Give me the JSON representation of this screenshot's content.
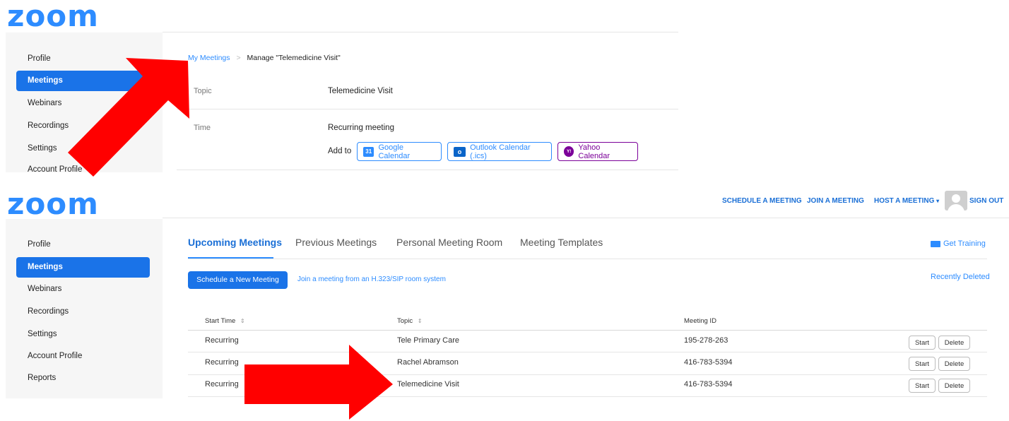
{
  "top_panel": {
    "logo": "zoom",
    "sidebar": [
      {
        "label": "Profile"
      },
      {
        "label": "Meetings"
      },
      {
        "label": "Webinars"
      },
      {
        "label": "Recordings"
      },
      {
        "label": "Settings"
      },
      {
        "label": "Account Profile"
      }
    ],
    "breadcrumb": {
      "root": "My Meetings",
      "separator": ">",
      "current": "Manage \"Telemedicine Visit\""
    },
    "topic_label": "Topic",
    "topic_value": "Telemedicine Visit",
    "time_label": "Time",
    "time_value": "Recurring meeting",
    "add_to_label": "Add to",
    "calendars": {
      "google": {
        "label": "Google Calendar",
        "icon_text": "31"
      },
      "outlook": {
        "label": "Outlook Calendar (.ics)",
        "icon_text": "o"
      },
      "yahoo": {
        "label": "Yahoo Calendar",
        "icon_text": "Y!"
      }
    }
  },
  "bottom_panel": {
    "logo": "zoom",
    "nav": {
      "schedule": "SCHEDULE A MEETING",
      "join": "JOIN A MEETING",
      "host": "HOST A MEETING",
      "sign_out": "SIGN OUT"
    },
    "sidebar": [
      {
        "label": "Profile"
      },
      {
        "label": "Meetings"
      },
      {
        "label": "Webinars"
      },
      {
        "label": "Recordings"
      },
      {
        "label": "Settings"
      },
      {
        "label": "Account Profile"
      },
      {
        "label": "Reports"
      }
    ],
    "tabs": [
      {
        "label": "Upcoming Meetings"
      },
      {
        "label": "Previous Meetings"
      },
      {
        "label": "Personal Meeting Room"
      },
      {
        "label": "Meeting Templates"
      }
    ],
    "get_training": "Get Training",
    "schedule_button": "Schedule a New Meeting",
    "join_room_link": "Join a meeting from an H.323/SIP room system",
    "recently_deleted": "Recently Deleted",
    "table": {
      "headers": {
        "start_time": "Start Time",
        "topic": "Topic",
        "meeting_id": "Meeting ID"
      },
      "sort_glyph": "⇕",
      "rows": [
        {
          "start": "Recurring",
          "topic": "Tele Primary Care",
          "id": "195-278-263",
          "start_btn": "Start",
          "delete_btn": "Delete"
        },
        {
          "start": "Recurring",
          "topic": "Rachel Abramson",
          "id": "416-783-5394",
          "start_btn": "Start",
          "delete_btn": "Delete"
        },
        {
          "start": "Recurring",
          "topic": "Telemedicine Visit",
          "id": "416-783-5394",
          "start_btn": "Start",
          "delete_btn": "Delete"
        }
      ]
    }
  },
  "colors": {
    "brand": "#2d8cff",
    "active": "#1a73e8",
    "arrow": "#ff0000",
    "yahoo": "#7b0099"
  }
}
